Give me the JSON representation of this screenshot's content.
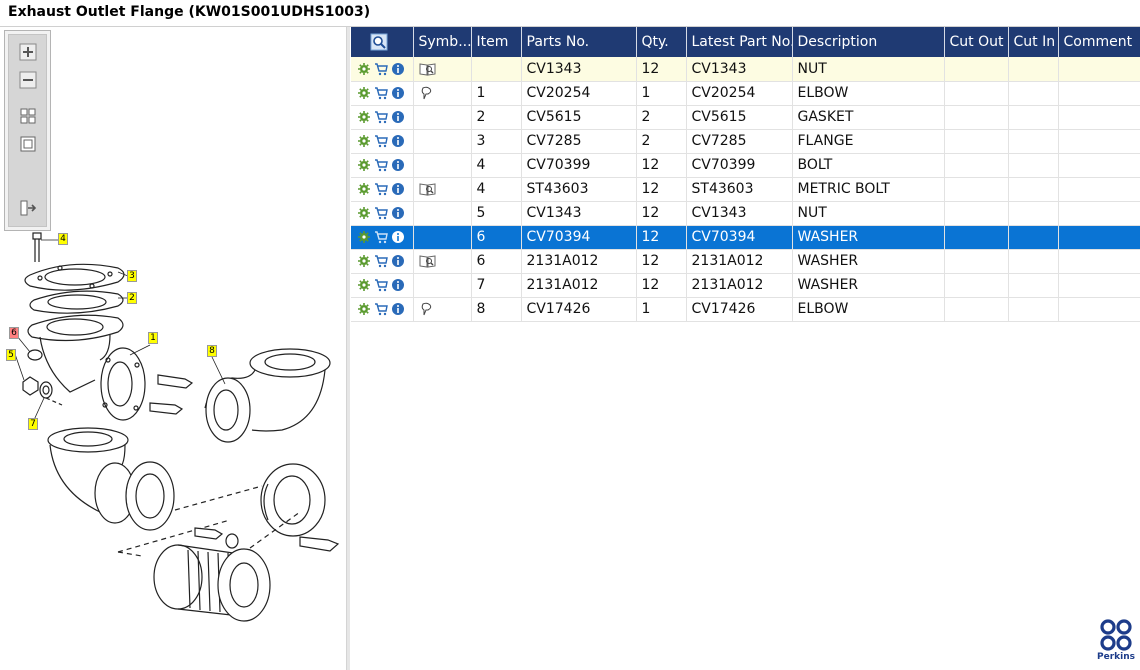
{
  "window": {
    "title": "Exhaust Outlet Flange (KW01S001UDHS1003)"
  },
  "toolbar": {
    "zoom_in": "zoom-in-icon",
    "zoom_out": "zoom-out-icon",
    "fit_all": "fit-all-icon",
    "fit_window": "fit-window-icon",
    "export": "export-icon"
  },
  "diagram": {
    "callouts": [
      "4",
      "3",
      "2",
      "6",
      "1",
      "5",
      "8",
      "7"
    ],
    "colors": {
      "callout_yellow": "#ffff00",
      "callout_red": "#ff8080",
      "line": "#222222"
    }
  },
  "table": {
    "columns": [
      "",
      "Symb...",
      "Item",
      "Parts No.",
      "Qty.",
      "Latest Part No.",
      "Description",
      "Cut Out",
      "Cut In",
      "Comment"
    ],
    "row_icons": [
      "gear-icon",
      "cart-icon",
      "info-icon"
    ],
    "rows": [
      {
        "symbol": "book",
        "item": "",
        "part_no": "CV1343",
        "qty": "12",
        "latest": "CV1343",
        "desc": "NUT",
        "cut_out": "",
        "cut_in": "",
        "comment": "",
        "state": "highlight"
      },
      {
        "symbol": "pin",
        "item": "1",
        "part_no": "CV20254",
        "qty": "1",
        "latest": "CV20254",
        "desc": "ELBOW",
        "cut_out": "",
        "cut_in": "",
        "comment": "",
        "state": ""
      },
      {
        "symbol": "",
        "item": "2",
        "part_no": "CV5615",
        "qty": "2",
        "latest": "CV5615",
        "desc": "GASKET",
        "cut_out": "",
        "cut_in": "",
        "comment": "",
        "state": ""
      },
      {
        "symbol": "",
        "item": "3",
        "part_no": "CV7285",
        "qty": "2",
        "latest": "CV7285",
        "desc": "FLANGE",
        "cut_out": "",
        "cut_in": "",
        "comment": "",
        "state": ""
      },
      {
        "symbol": "",
        "item": "4",
        "part_no": "CV70399",
        "qty": "12",
        "latest": "CV70399",
        "desc": "BOLT",
        "cut_out": "",
        "cut_in": "",
        "comment": "",
        "state": ""
      },
      {
        "symbol": "book",
        "item": "4",
        "part_no": "ST43603",
        "qty": "12",
        "latest": "ST43603",
        "desc": "METRIC BOLT",
        "cut_out": "",
        "cut_in": "",
        "comment": "",
        "state": ""
      },
      {
        "symbol": "",
        "item": "5",
        "part_no": "CV1343",
        "qty": "12",
        "latest": "CV1343",
        "desc": "NUT",
        "cut_out": "",
        "cut_in": "",
        "comment": "",
        "state": ""
      },
      {
        "symbol": "",
        "item": "6",
        "part_no": "CV70394",
        "qty": "12",
        "latest": "CV70394",
        "desc": "WASHER",
        "cut_out": "",
        "cut_in": "",
        "comment": "",
        "state": "selected"
      },
      {
        "symbol": "book",
        "item": "6",
        "part_no": "2131A012",
        "qty": "12",
        "latest": "2131A012",
        "desc": "WASHER",
        "cut_out": "",
        "cut_in": "",
        "comment": "",
        "state": ""
      },
      {
        "symbol": "",
        "item": "7",
        "part_no": "2131A012",
        "qty": "12",
        "latest": "2131A012",
        "desc": "WASHER",
        "cut_out": "",
        "cut_in": "",
        "comment": "",
        "state": ""
      },
      {
        "symbol": "pin",
        "item": "8",
        "part_no": "CV17426",
        "qty": "1",
        "latest": "CV17426",
        "desc": "ELBOW",
        "cut_out": "",
        "cut_in": "",
        "comment": "",
        "state": ""
      }
    ]
  },
  "brand": {
    "name": "Perkins",
    "color": "#1d3c8a"
  },
  "colors": {
    "header": "#1f3a73",
    "selected": "#0a74d4",
    "highlight": "#fdfce2",
    "gear": "#5a9a2e",
    "cart": "#2a6ab8",
    "info": "#2a6ab8"
  }
}
